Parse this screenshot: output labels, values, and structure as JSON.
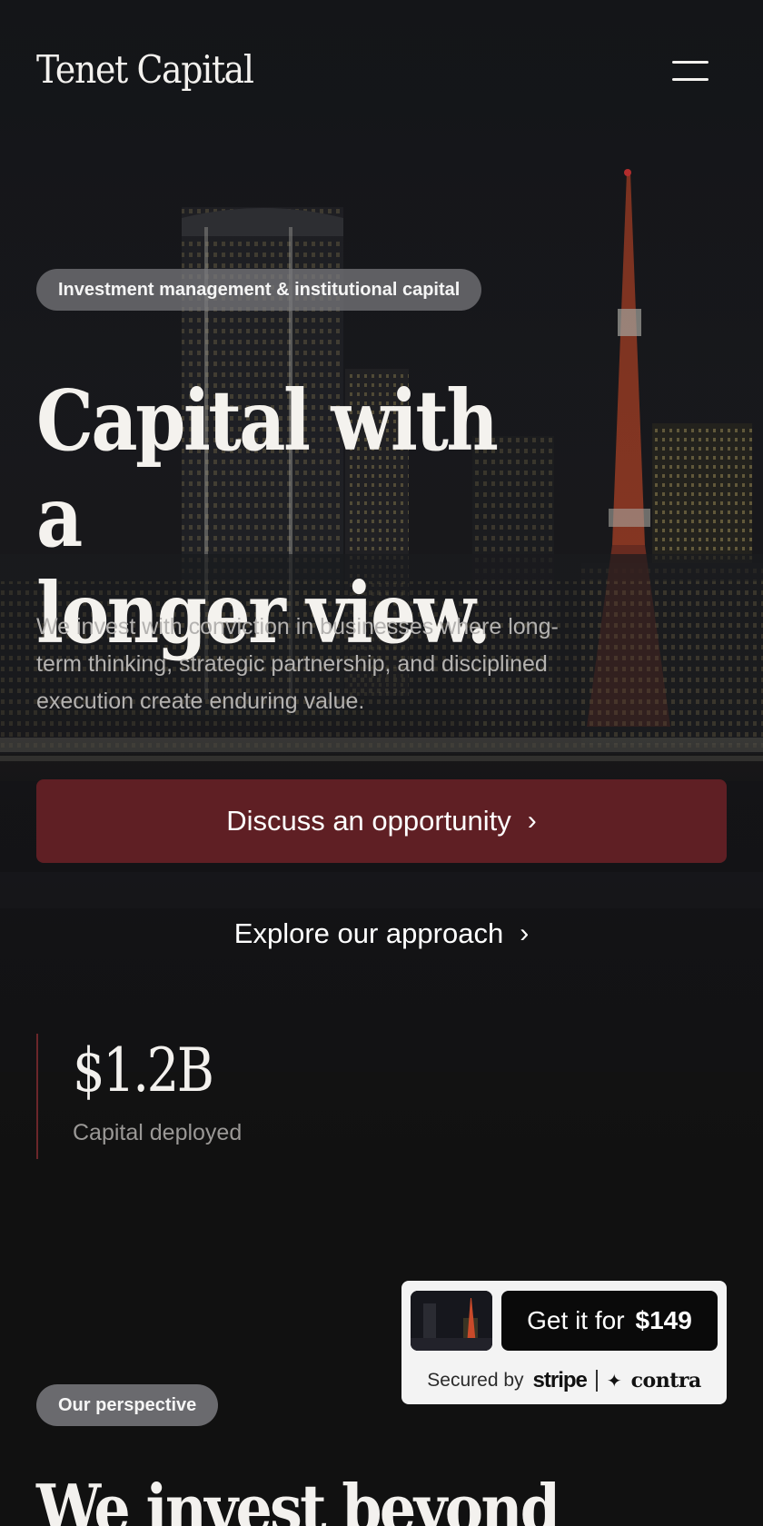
{
  "header": {
    "logo": "Tenet Capital",
    "menu_icon": "hamburger-menu-icon"
  },
  "hero": {
    "tagline": "Investment management & institutional capital",
    "headline_line1": "Capital with a",
    "headline_line2": "longer view.",
    "subcopy": "We invest with conviction in businesses where long-term thinking, strategic partnership, and disciplined execution create enduring value.",
    "primary_cta": "Discuss an opportunity",
    "secondary_cta": "Explore our approach",
    "cta_icon": "chevron-right-icon",
    "background": "night-city-skyline-image"
  },
  "stats": {
    "value": "$1.2B",
    "label": "Capital deployed"
  },
  "purchase": {
    "button_prefix": "Get it for",
    "price": "$149",
    "secured_label": "Secured by",
    "brand1": "stripe",
    "brand2": "contra"
  },
  "perspective": {
    "tag": "Our perspective",
    "title": "We invest beyond"
  },
  "colors": {
    "accent": "#5f1f24",
    "background": "#111111",
    "text": "#f3f1ee"
  }
}
